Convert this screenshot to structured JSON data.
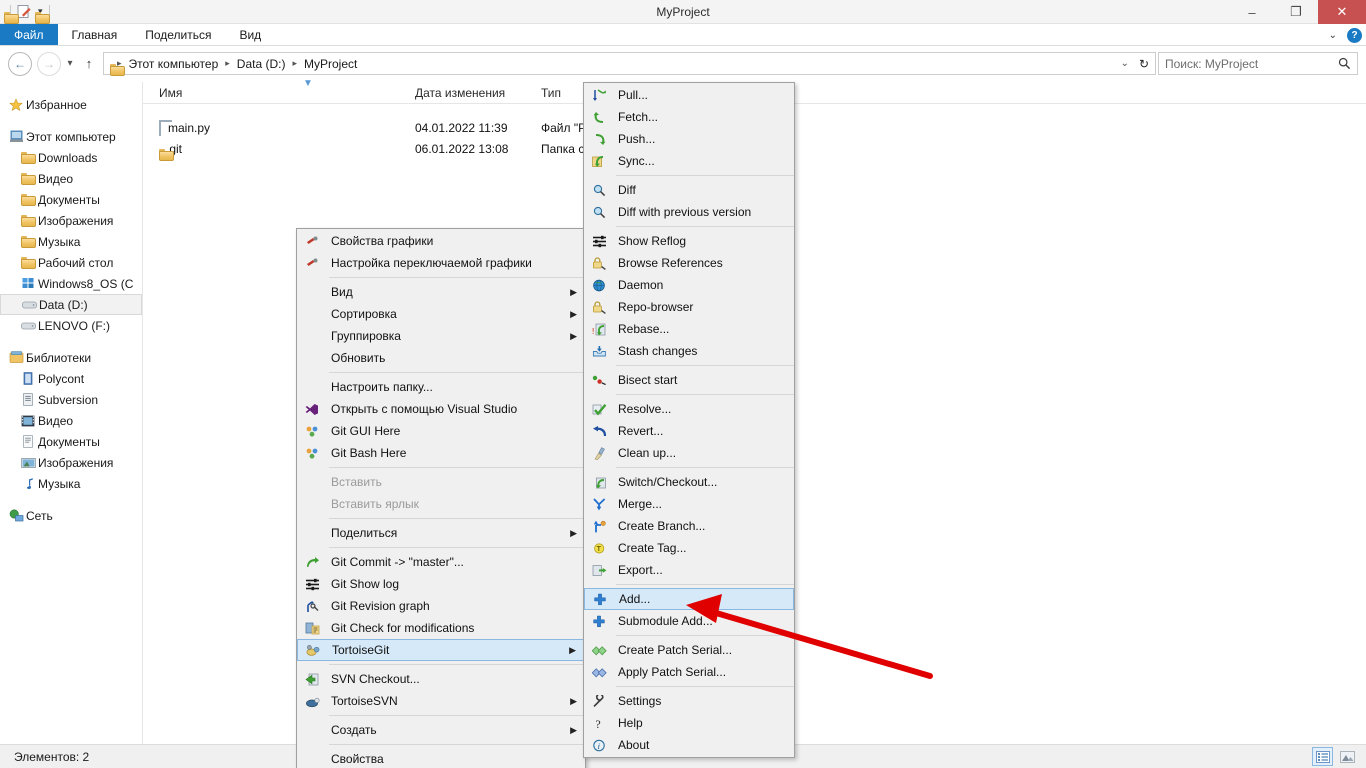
{
  "window": {
    "title": "MyProject",
    "minimize_label": "–",
    "maximize_label": "❐",
    "close_label": "✕"
  },
  "quick_access": {
    "items": [
      {
        "name": "folder-icon",
        "label": ""
      },
      {
        "name": "properties-icon",
        "label": ""
      },
      {
        "name": "new-folder-icon",
        "label": ""
      },
      {
        "name": "customize-dropdown-icon",
        "label": "▾"
      }
    ]
  },
  "ribbon": {
    "tabs": [
      {
        "label": "Файл",
        "active": true
      },
      {
        "label": "Главная",
        "active": false
      },
      {
        "label": "Поделиться",
        "active": false
      },
      {
        "label": "Вид",
        "active": false
      }
    ],
    "collapse_label": "⌄",
    "help_label": "?"
  },
  "address_bar": {
    "back_label": "←",
    "forward_label": "→",
    "recent_label": "▾",
    "up_label": "↑",
    "breadcrumbs": [
      "Этот компьютер",
      "Data (D:)",
      "MyProject"
    ],
    "separator": "▸",
    "dropdown_label": "⌄",
    "refresh_label": "↻",
    "search_placeholder": "Поиск: MyProject",
    "search_value": "",
    "search_icon": "⚲"
  },
  "nav_pane": {
    "groups": [
      {
        "header": {
          "label": "Избранное",
          "icon": "star-icon"
        },
        "items": []
      },
      {
        "header": {
          "label": "Этот компьютер",
          "icon": "computer-icon"
        },
        "items": [
          {
            "label": "Downloads",
            "icon": "downloads-folder-icon",
            "selected": false
          },
          {
            "label": "Видео",
            "icon": "video-folder-icon",
            "selected": false
          },
          {
            "label": "Документы",
            "icon": "documents-folder-icon",
            "selected": false
          },
          {
            "label": "Изображения",
            "icon": "pictures-folder-icon",
            "selected": false
          },
          {
            "label": "Музыка",
            "icon": "music-folder-icon",
            "selected": false
          },
          {
            "label": "Рабочий стол",
            "icon": "desktop-folder-icon",
            "selected": false
          },
          {
            "label": "Windows8_OS (C",
            "icon": "windows-drive-icon",
            "selected": false
          },
          {
            "label": "Data (D:)",
            "icon": "drive-icon",
            "selected": true
          },
          {
            "label": "LENOVO (F:)",
            "icon": "drive-icon",
            "selected": false
          }
        ]
      },
      {
        "header": {
          "label": "Библиотеки",
          "icon": "libraries-icon"
        },
        "items": [
          {
            "label": "Polycont",
            "icon": "library-icon",
            "selected": false
          },
          {
            "label": "Subversion",
            "icon": "library-icon",
            "selected": false
          },
          {
            "label": "Видео",
            "icon": "video-library-icon",
            "selected": false
          },
          {
            "label": "Документы",
            "icon": "documents-library-icon",
            "selected": false
          },
          {
            "label": "Изображения",
            "icon": "pictures-library-icon",
            "selected": false
          },
          {
            "label": "Музыка",
            "icon": "music-note-icon",
            "selected": false
          }
        ]
      },
      {
        "header": {
          "label": "Сеть",
          "icon": "network-icon"
        },
        "items": []
      }
    ]
  },
  "file_list": {
    "columns": [
      {
        "label": "Имя"
      },
      {
        "label": "Дата изменения"
      },
      {
        "label": "Тип"
      }
    ],
    "rows": [
      {
        "name": "main.py",
        "icon": "python-file-icon",
        "date": "04.01.2022 11:39",
        "type": "Файл \"P"
      },
      {
        "name": ".git",
        "icon": "folder-icon",
        "date": "06.01.2022 13:08",
        "type": "Папка с"
      }
    ]
  },
  "status_bar": {
    "items_label": "Элементов: 2",
    "details_view_icon": "details-view-icon",
    "large_icons_view_icon": "large-icons-view-icon"
  },
  "context_menu": {
    "items": [
      {
        "label": "Свойства графики",
        "icon": "intel-graphics-icon",
        "submenu": false,
        "disabled": false,
        "separator_after": false
      },
      {
        "label": "Настройка переключаемой графики",
        "icon": "intel-graphics-icon",
        "submenu": false,
        "disabled": false,
        "separator_after": true
      },
      {
        "label": "Вид",
        "icon": "",
        "submenu": true,
        "disabled": false,
        "separator_after": false
      },
      {
        "label": "Сортировка",
        "icon": "",
        "submenu": true,
        "disabled": false,
        "separator_after": false
      },
      {
        "label": "Группировка",
        "icon": "",
        "submenu": true,
        "disabled": false,
        "separator_after": false
      },
      {
        "label": "Обновить",
        "icon": "",
        "submenu": false,
        "disabled": false,
        "separator_after": true
      },
      {
        "label": "Настроить папку...",
        "icon": "",
        "submenu": false,
        "disabled": false,
        "separator_after": false
      },
      {
        "label": "Открыть с помощью Visual Studio",
        "icon": "visual-studio-icon",
        "submenu": false,
        "disabled": false,
        "separator_after": false
      },
      {
        "label": "Git GUI Here",
        "icon": "git-icon",
        "submenu": false,
        "disabled": false,
        "separator_after": false
      },
      {
        "label": "Git Bash Here",
        "icon": "git-icon",
        "submenu": false,
        "disabled": false,
        "separator_after": true
      },
      {
        "label": "Вставить",
        "icon": "",
        "submenu": false,
        "disabled": true,
        "separator_after": false
      },
      {
        "label": "Вставить ярлык",
        "icon": "",
        "submenu": false,
        "disabled": true,
        "separator_after": true
      },
      {
        "label": "Поделиться",
        "icon": "",
        "submenu": true,
        "disabled": false,
        "separator_after": true
      },
      {
        "label": "Git Commit -> \"master\"...",
        "icon": "git-commit-icon",
        "submenu": false,
        "disabled": false,
        "separator_after": false
      },
      {
        "label": "Git Show log",
        "icon": "git-log-icon",
        "submenu": false,
        "disabled": false,
        "separator_after": false
      },
      {
        "label": "Git Revision graph",
        "icon": "git-revision-graph-icon",
        "submenu": false,
        "disabled": false,
        "separator_after": false
      },
      {
        "label": "Git Check for modifications",
        "icon": "git-check-modifications-icon",
        "submenu": false,
        "disabled": false,
        "separator_after": false
      },
      {
        "label": "TortoiseGit",
        "icon": "tortoisegit-icon",
        "submenu": true,
        "disabled": false,
        "highlighted": true,
        "separator_after": true
      },
      {
        "label": "SVN Checkout...",
        "icon": "svn-checkout-icon",
        "submenu": false,
        "disabled": false,
        "separator_after": false
      },
      {
        "label": "TortoiseSVN",
        "icon": "tortoisesvn-icon",
        "submenu": true,
        "disabled": false,
        "separator_after": true
      },
      {
        "label": "Создать",
        "icon": "",
        "submenu": true,
        "disabled": false,
        "separator_after": true
      },
      {
        "label": "Свойства",
        "icon": "",
        "submenu": false,
        "disabled": false,
        "separator_after": false
      }
    ]
  },
  "tortoisegit_submenu": {
    "items": [
      {
        "label": "Pull...",
        "icon": "pull-icon",
        "separator_after": false
      },
      {
        "label": "Fetch...",
        "icon": "fetch-icon",
        "separator_after": false
      },
      {
        "label": "Push...",
        "icon": "push-icon",
        "separator_after": false
      },
      {
        "label": "Sync...",
        "icon": "sync-icon",
        "separator_after": true
      },
      {
        "label": "Diff",
        "icon": "diff-icon",
        "separator_after": false
      },
      {
        "label": "Diff with previous version",
        "icon": "diff-previous-icon",
        "separator_after": true
      },
      {
        "label": "Show Reflog",
        "icon": "reflog-icon",
        "separator_after": false
      },
      {
        "label": "Browse References",
        "icon": "browse-references-icon",
        "separator_after": false
      },
      {
        "label": "Daemon",
        "icon": "daemon-icon",
        "separator_after": false
      },
      {
        "label": "Repo-browser",
        "icon": "repo-browser-icon",
        "separator_after": false
      },
      {
        "label": "Rebase...",
        "icon": "rebase-icon",
        "separator_after": false
      },
      {
        "label": "Stash changes",
        "icon": "stash-icon",
        "separator_after": true
      },
      {
        "label": "Bisect start",
        "icon": "bisect-icon",
        "separator_after": true
      },
      {
        "label": "Resolve...",
        "icon": "resolve-icon",
        "separator_after": false
      },
      {
        "label": "Revert...",
        "icon": "revert-icon",
        "separator_after": false
      },
      {
        "label": "Clean up...",
        "icon": "cleanup-icon",
        "separator_after": true
      },
      {
        "label": "Switch/Checkout...",
        "icon": "switch-checkout-icon",
        "separator_after": false
      },
      {
        "label": "Merge...",
        "icon": "merge-icon",
        "separator_after": false
      },
      {
        "label": "Create Branch...",
        "icon": "create-branch-icon",
        "separator_after": false
      },
      {
        "label": "Create Tag...",
        "icon": "create-tag-icon",
        "separator_after": false
      },
      {
        "label": "Export...",
        "icon": "export-icon",
        "separator_after": true
      },
      {
        "label": "Add...",
        "icon": "add-icon",
        "highlighted": true,
        "separator_after": false
      },
      {
        "label": "Submodule Add...",
        "icon": "submodule-add-icon",
        "separator_after": true
      },
      {
        "label": "Create Patch Serial...",
        "icon": "create-patch-icon",
        "separator_after": false
      },
      {
        "label": "Apply Patch Serial...",
        "icon": "apply-patch-icon",
        "separator_after": true
      },
      {
        "label": "Settings",
        "icon": "settings-icon",
        "separator_after": false
      },
      {
        "label": "Help",
        "icon": "help-icon",
        "separator_after": false
      },
      {
        "label": "About",
        "icon": "about-icon",
        "separator_after": false
      }
    ]
  },
  "annotation": {
    "arrow_color": "#e00000",
    "points_to": "Add..."
  },
  "colors": {
    "accent": "#1a7bc4",
    "close_button": "#c75050",
    "menu_bg": "#f0f0f0",
    "highlight_bg": "#d6e9f8",
    "highlight_border": "#8ab8e0",
    "selected_nav_bg": "#f2f2f2"
  }
}
